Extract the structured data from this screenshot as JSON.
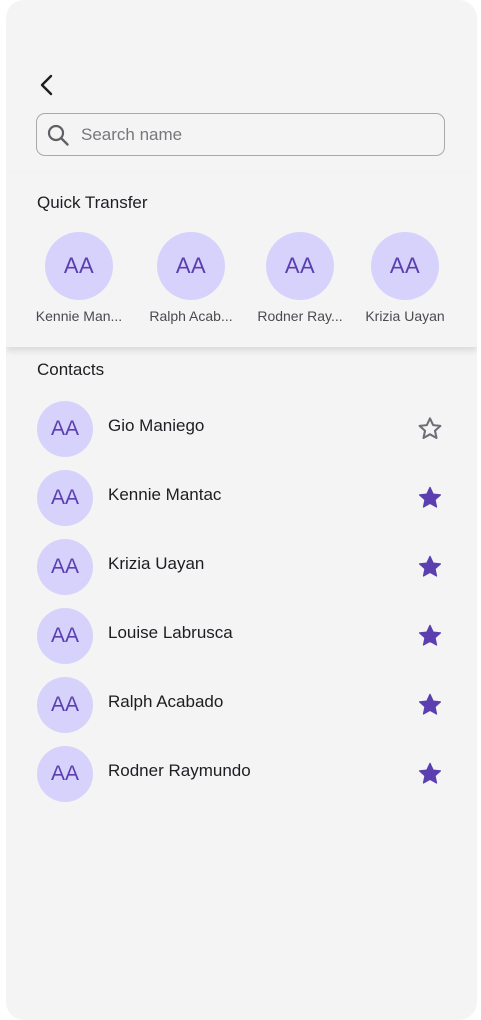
{
  "search": {
    "placeholder": "Search name",
    "value": ""
  },
  "quick_transfer": {
    "title": "Quick Transfer",
    "items": [
      {
        "initials": "AA",
        "name": "Kennie Man..."
      },
      {
        "initials": "AA",
        "name": "Ralph Acab..."
      },
      {
        "initials": "AA",
        "name": "Rodner Ray..."
      },
      {
        "initials": "AA",
        "name": "Krizia Uayan"
      }
    ]
  },
  "contacts": {
    "title": "Contacts",
    "items": [
      {
        "initials": "AA",
        "name": "Gio Maniego",
        "favorite": false
      },
      {
        "initials": "AA",
        "name": "Kennie Mantac",
        "favorite": true
      },
      {
        "initials": "AA",
        "name": "Krizia Uayan",
        "favorite": true
      },
      {
        "initials": "AA",
        "name": "Louise Labrusca",
        "favorite": true
      },
      {
        "initials": "AA",
        "name": "Ralph Acabado",
        "favorite": true
      },
      {
        "initials": "AA",
        "name": "Rodner Raymundo",
        "favorite": true
      }
    ]
  },
  "icons": {
    "back": "chevron-left-icon",
    "search": "search-icon",
    "favorite_on": "star-filled-icon",
    "favorite_off": "star-outline-icon"
  },
  "colors": {
    "accent": "#5b3fb0",
    "avatar_bg": "#d7d2fb",
    "star_outline": "#6e6e76"
  }
}
